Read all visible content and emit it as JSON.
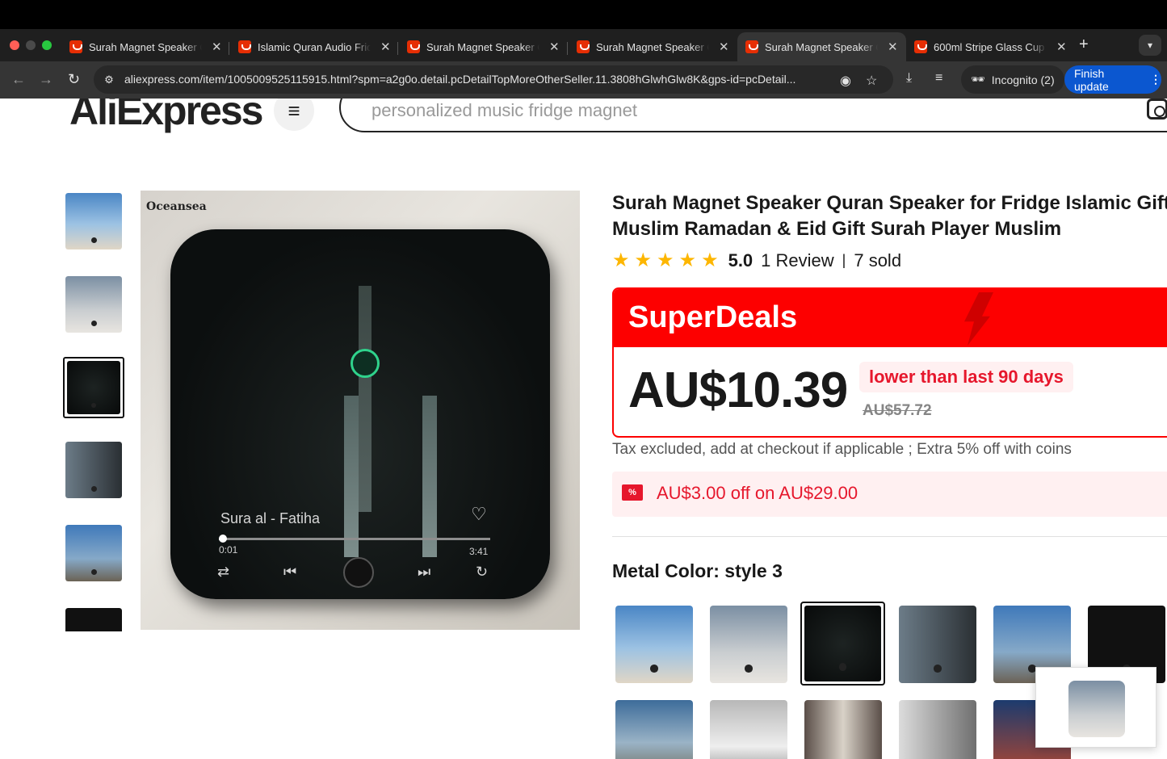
{
  "browser": {
    "tabs": [
      {
        "title": "Surah Magnet Speaker Q",
        "active": false
      },
      {
        "title": "Islamic Quran Audio Frid",
        "active": false
      },
      {
        "title": "Surah Magnet Speaker Q",
        "active": false
      },
      {
        "title": "Surah Magnet Speaker Q",
        "active": false
      },
      {
        "title": "Surah Magnet Speaker Q",
        "active": true
      },
      {
        "title": "600ml Stripe Glass Cup",
        "active": false
      }
    ],
    "url": "aliexpress.com/item/1005009525115915.html?spm=a2g0o.detail.pcDetailTopMoreOtherSeller.11.3808hGlwhGlw8K&gps-id=pcDetail...",
    "incognito_label": "Incognito (2)",
    "finish_update_label": "Finish update"
  },
  "site": {
    "logo": "AliExpress",
    "search_placeholder": "personalized music fridge magnet"
  },
  "product": {
    "title": "Surah Magnet Speaker Quran Speaker for Fridge Islamic Gift Muslim Ramadan & Eid Gift Surah Player Muslim",
    "rating": "5.0",
    "reviews": "1 Review",
    "sold": "7 sold",
    "deal_label": "SuperDeals",
    "price": "AU$10.39",
    "price_note": "lower than last 90 days",
    "original_price": "AU$57.72",
    "tax_note": "Tax excluded, add at checkout if applicable ; Extra 5% off with coins",
    "coupon": "AU$3.00 off on AU$29.00",
    "coupon_icon": "%",
    "color_label": "Metal Color: style 3"
  },
  "main_image": {
    "brand": "Oceansea",
    "track": "Sura al - Fatiha",
    "time_current": "0:01",
    "time_total": "3:41",
    "progress": 0.01
  },
  "colors": {
    "accent": "#fd0000",
    "price_red": "#e6172c",
    "star": "#fdb600",
    "primary_button": "#0b57d0"
  }
}
